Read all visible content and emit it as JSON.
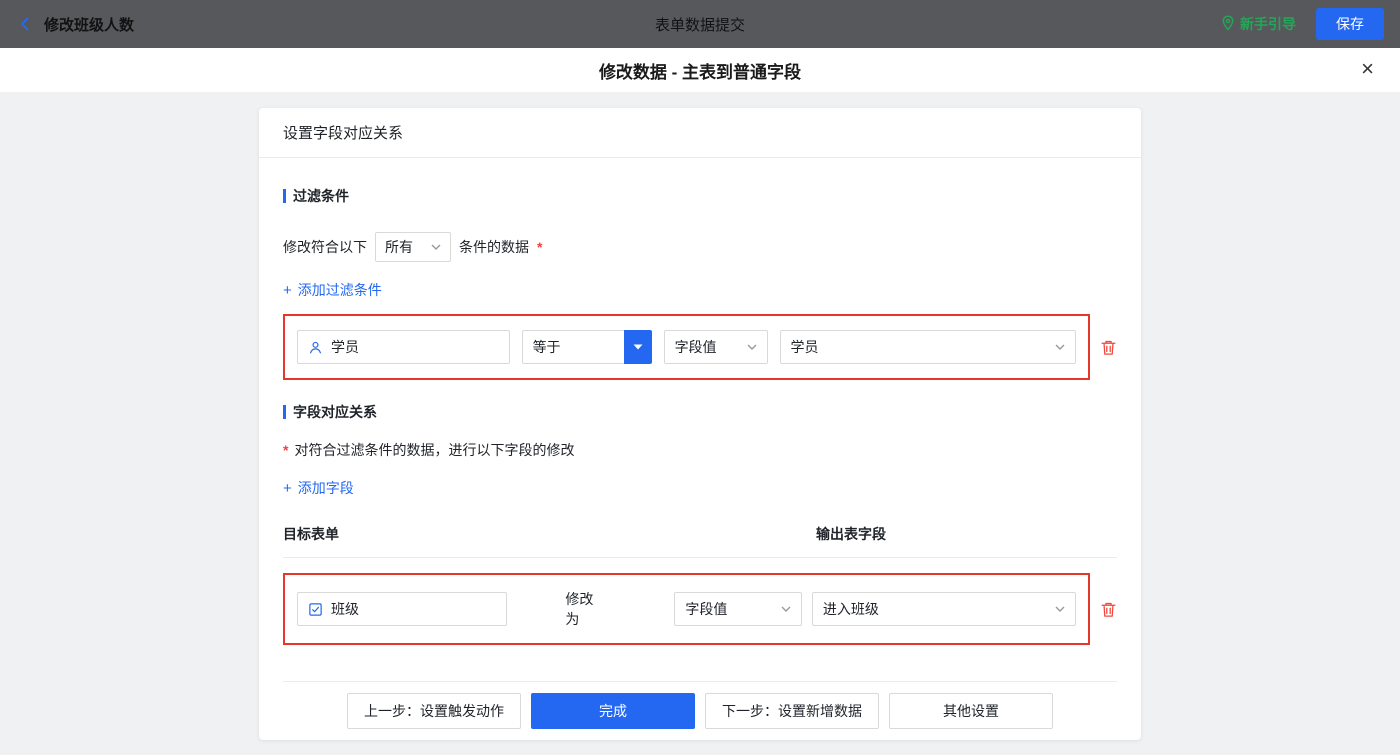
{
  "topbar": {
    "back_label": "修改班级人数",
    "title": "表单数据提交",
    "guide_label": "新手引导",
    "save_label": "保存"
  },
  "modal": {
    "title": "修改数据 - 主表到普通字段"
  },
  "icons": {
    "plus": "+",
    "close": "×"
  },
  "panel": {
    "header": "设置字段对应关系",
    "filter": {
      "section_title": "过滤条件",
      "prefix": "修改符合以下",
      "match_option": "所有",
      "suffix": "条件的数据",
      "required": "*",
      "add_label": "添加过滤条件",
      "row": {
        "field": "学员",
        "operator": "等于",
        "value_type": "字段值",
        "value": "学员"
      }
    },
    "mapping": {
      "section_title": "字段对应关系",
      "required": "*",
      "description": "对符合过滤条件的数据，进行以下字段的修改",
      "add_label": "添加字段",
      "columns": {
        "target": "目标表单",
        "output": "输出表字段"
      },
      "row": {
        "field": "班级",
        "action": "修改为",
        "value_type": "字段值",
        "value": "进入班级"
      }
    },
    "footer": {
      "prev": "上一步：设置触发动作",
      "done": "完成",
      "next": "下一步：设置新增数据",
      "other": "其他设置"
    }
  },
  "colors": {
    "accent_blue": "#2468f2",
    "annotation_red": "#e5382a",
    "success_green": "#23a757",
    "danger_red": "#f0483e"
  }
}
